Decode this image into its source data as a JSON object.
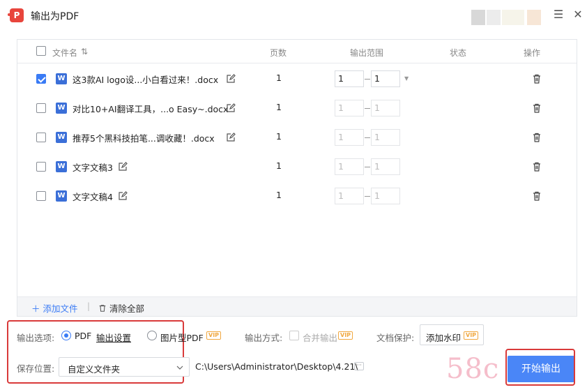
{
  "window": {
    "app_logo": "P",
    "title": "输出为PDF"
  },
  "table": {
    "headers": {
      "filename": "文件名",
      "sort_icon": "⇅",
      "pages": "页数",
      "range": "输出范围",
      "status": "状态",
      "action": "操作"
    },
    "rows": [
      {
        "checked": true,
        "name": "这3款AI logo设...小白看过来！.docx",
        "pages": "1",
        "from": "1",
        "to": "1",
        "active": true
      },
      {
        "checked": false,
        "name": "对比10+AI翻译工具，...o Easy~.docx",
        "pages": "1",
        "from": "1",
        "to": "1",
        "active": false
      },
      {
        "checked": false,
        "name": "推荐5个黑科技拍笔...调收藏！.docx",
        "pages": "1",
        "from": "1",
        "to": "1",
        "active": false
      },
      {
        "checked": false,
        "name": "文字文稿3",
        "pages": "1",
        "from": "1",
        "to": "1",
        "active": false
      },
      {
        "checked": false,
        "name": "文字文稿4",
        "pages": "1",
        "from": "1",
        "to": "1",
        "active": false
      }
    ],
    "footer": {
      "add_file": "＋ 添加文件",
      "separator": "|",
      "clear_all": "清除全部"
    }
  },
  "options": {
    "output_options_label": "输出选项:",
    "pdf_label": "PDF",
    "output_settings_link": "输出设置",
    "image_pdf_label": "图片型PDF",
    "vip": "VIP",
    "output_mode_label": "输出方式:",
    "merge_output_label": "合并输出",
    "doc_protect_label": "文档保护:",
    "add_watermark_label": "添加水印",
    "save_location_label": "保存位置:",
    "save_location_value": "自定义文件夹",
    "save_path": "C:\\Users\\Administrator\\Desktop\\4.21\\",
    "more": "···",
    "start_button": "开始输出",
    "site_watermark": "58c"
  },
  "colors": {
    "accent": "#3a7bf5",
    "start_button": "#4a86f7",
    "vip": "#f0a840",
    "highlight": "#d93a3a",
    "word_icon": "#3b6fd8"
  }
}
